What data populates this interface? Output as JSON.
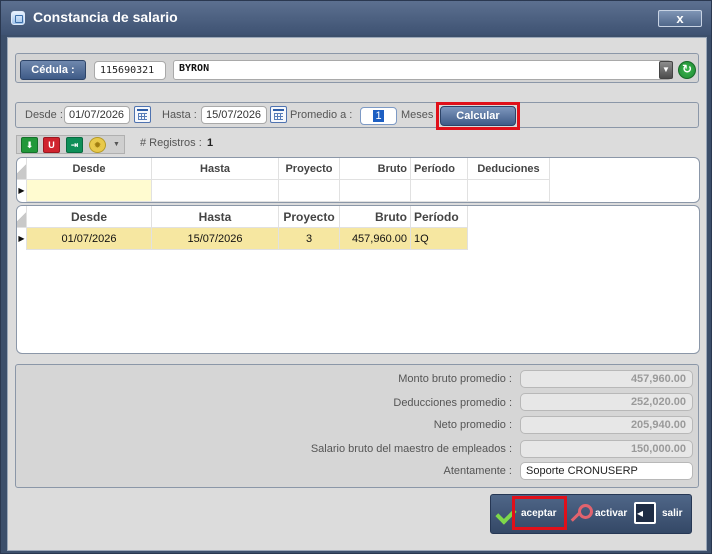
{
  "window": {
    "title": "Constancia de salario",
    "close_label": "x"
  },
  "employee": {
    "cedula_label": "Cédula :",
    "cedula_value": "115690321",
    "name_value": "BYRON"
  },
  "dates": {
    "desde_label": "Desde :",
    "desde_value": "01/07/2026",
    "hasta_label": "Hasta :",
    "hasta_value": "15/07/2026",
    "promedio_label": "Promedio a :",
    "meses_value": "1",
    "meses_label": "Meses",
    "calcular_label": "Calcular"
  },
  "toolbar": {
    "registros_label": "# Registros :",
    "registros_count": "1"
  },
  "grid_top": {
    "columns": [
      "Desde",
      "Hasta",
      "Proyecto",
      "Bruto",
      "Período",
      "Deduciones"
    ]
  },
  "grid_bottom": {
    "columns": [
      "Desde",
      "Hasta",
      "Proyecto",
      "Bruto",
      "Período"
    ],
    "rows": [
      {
        "desde": "01/07/2026",
        "hasta": "15/07/2026",
        "proyecto": "3",
        "bruto": "457,960.00",
        "periodo": "1Q"
      }
    ]
  },
  "summary": {
    "monto_bruto_label": "Monto bruto promedio :",
    "monto_bruto_value": "457,960.00",
    "deducciones_label": "Deducciones promedio :",
    "deducciones_value": "252,020.00",
    "neto_label": "Neto promedio :",
    "neto_value": "205,940.00",
    "salario_label": "Salario bruto del maestro de empleados :",
    "salario_value": "150,000.00",
    "atentamente_label": "Atentamente :",
    "atentamente_value": "Soporte CRONUSERP"
  },
  "actions": {
    "aceptar": "aceptar",
    "activar": "activar",
    "salir": "salir"
  },
  "colors": {
    "title_bar": "#4a5e80",
    "selected_row": "#f6e7a1",
    "new_row": "#fffbd0",
    "highlight": "#e0101a"
  }
}
